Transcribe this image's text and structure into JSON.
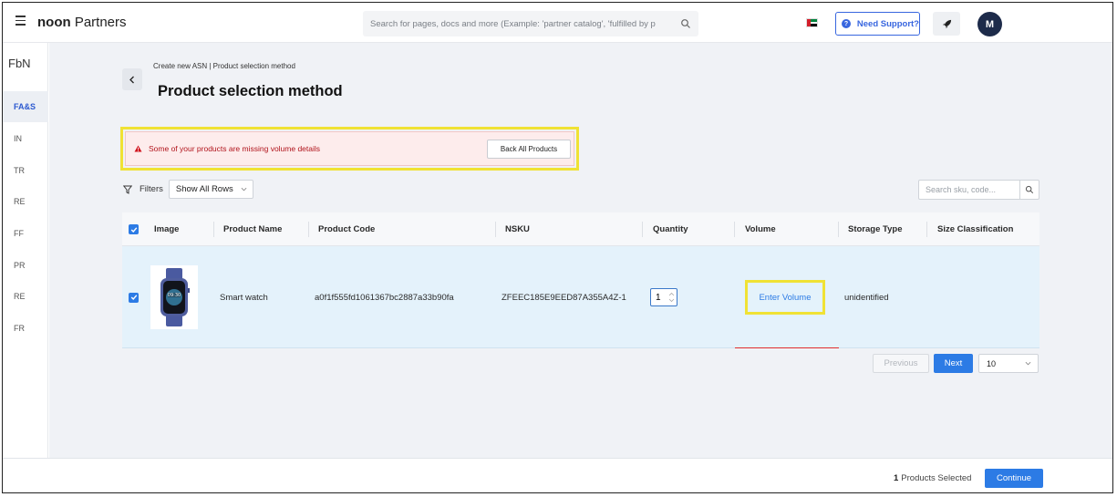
{
  "header": {
    "brand_bold": "noon",
    "brand_rest": " Partners",
    "search_placeholder": "Search for pages, docs and more (Example: 'partner catalog', 'fulfilled by p",
    "support_label": "Need Support?",
    "avatar_initial": "M",
    "flag": "UAE",
    "icons": [
      "menu-icon",
      "search-icon",
      "help-icon",
      "rocket-icon"
    ]
  },
  "sidebar": {
    "title": "FbN",
    "items": [
      {
        "label": "FA&S",
        "active": true
      },
      {
        "label": "IN",
        "active": false
      },
      {
        "label": "TR",
        "active": false
      },
      {
        "label": "RE",
        "active": false
      },
      {
        "label": "FF",
        "active": false
      },
      {
        "label": "PR",
        "active": false
      },
      {
        "label": "RE",
        "active": false
      },
      {
        "label": "FR",
        "active": false
      }
    ]
  },
  "page": {
    "breadcrumb": "Create new ASN |  Product selection method",
    "title": "Product selection method"
  },
  "alert": {
    "message": "Some of your products are missing volume details",
    "button_label": "Back All Products",
    "color": "#b1141c"
  },
  "toolbar": {
    "filters_label": "Filters",
    "filter_value": "Show All Rows",
    "search_placeholder": "Search sku, code..."
  },
  "table": {
    "columns": [
      "Image",
      "Product Name",
      "Product Code",
      "NSKU",
      "Quantity",
      "Volume",
      "Storage Type",
      "Size Classification"
    ],
    "rows": [
      {
        "checked": true,
        "image": "Smart watch image",
        "product_name": "Smart watch",
        "product_code": "a0f1f555fd1061367bc2887a33b90fa",
        "nsku": "ZFEEC185E9EED87A355A4Z-1",
        "quantity": "1",
        "volume_action": "Enter Volume",
        "storage_type": "unidentified",
        "size_classification": ""
      }
    ]
  },
  "pagination": {
    "previous_label": "Previous",
    "next_label": "Next",
    "page_size": "10"
  },
  "footer": {
    "selected_count": "1",
    "selected_label": "Products Selected",
    "continue_label": "Continue"
  },
  "colors": {
    "accent": "#2c7be5",
    "highlight": "#f0e234",
    "row_bg": "#e4f2fb"
  }
}
